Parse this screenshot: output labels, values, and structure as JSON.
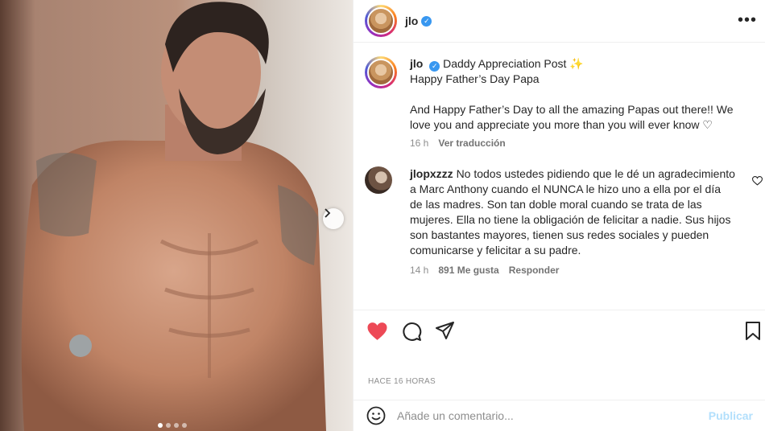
{
  "post": {
    "author": "jlo",
    "verified_icon": "verified-badge-icon",
    "more_icon": "more-options-icon",
    "media": {
      "slides_total": 4,
      "active_slide": 1,
      "next_icon": "chevron-right-icon"
    }
  },
  "caption": {
    "author": "jlo",
    "line1": "Daddy Appreciation Post ✨",
    "line2": "Happy Father’s Day Papa",
    "body": "And Happy Father’s Day to all the amazing Papas out there!! We love you and appreciate you more than you will ever know ♡",
    "time": "16 h",
    "translate": "Ver traducción"
  },
  "comments": [
    {
      "author": "jlopxzzz",
      "text": "No todos ustedes pidiendo que le dé un agradecimiento a Marc Anthony cuando el NUNCA le hizo uno a ella por el día de las madres. Son tan doble moral cuando se trata de las mujeres. Ella no tiene la obligación de felicitar a nadie. Sus hijos son bastantes mayores, tienen sus redes sociales y pueden comunicarse y felicitar a su padre.",
      "time": "14 h",
      "likes": "891 Me gusta",
      "reply": "Responder"
    }
  ],
  "actions": {
    "like_icon": "heart-filled-icon",
    "comment_icon": "comment-icon",
    "share_icon": "paper-plane-icon",
    "save_icon": "bookmark-icon",
    "like_color": "#ed4956"
  },
  "timestamp": "HACE 16 HORAS",
  "add_comment": {
    "emoji_icon": "emoji-icon",
    "placeholder": "Añade un comentario...",
    "publish": "Publicar"
  }
}
